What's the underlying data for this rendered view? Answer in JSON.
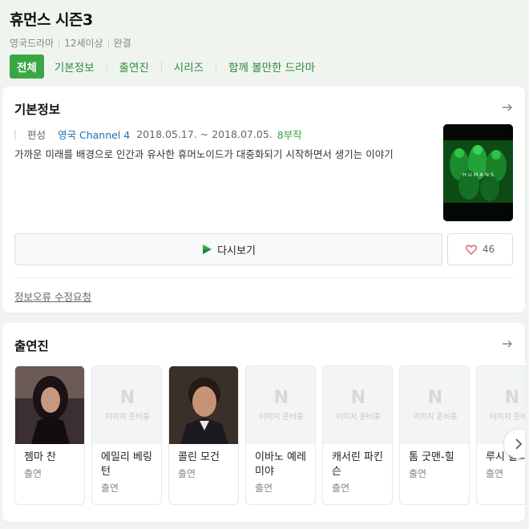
{
  "header": {
    "title": "휴먼스 시즌3",
    "meta": [
      "영국드라마",
      "12세이상",
      "완결"
    ]
  },
  "tabs": [
    {
      "label": "전체",
      "active": true
    },
    {
      "label": "기본정보",
      "active": false
    },
    {
      "label": "출연진",
      "active": false
    },
    {
      "label": "시리즈",
      "active": false
    },
    {
      "label": "함께 볼만한 드라마",
      "active": false
    }
  ],
  "info": {
    "section_title": "기본정보",
    "label": "편성",
    "network": "영국 Channel 4",
    "dates": "2018.05.17. ~ 2018.07.05.",
    "episodes": "8부작",
    "synopsis": "가까운 미래를 배경으로 인간과 유사한 휴머노이드가 대중화되기 시작하면서 생기는 이야기",
    "poster_text": "H U M A N S",
    "watch_label": "다시보기",
    "like_count": "46",
    "report_label": "정보오류 수정요청"
  },
  "cast": {
    "section_title": "출연진",
    "placeholder_n": "N",
    "placeholder_text": "이미지 준비중",
    "members": [
      {
        "name": "젬마 찬",
        "role": "출연",
        "has_photo": true
      },
      {
        "name": "에밀리 베링턴",
        "role": "출연",
        "has_photo": false
      },
      {
        "name": "콜린 모건",
        "role": "출연",
        "has_photo": true
      },
      {
        "name": "이바노 예레미야",
        "role": "출연",
        "has_photo": false
      },
      {
        "name": "캐서린 파킨슨",
        "role": "출연",
        "has_photo": false
      },
      {
        "name": "톰 굿맨-힐",
        "role": "출연",
        "has_photo": false
      },
      {
        "name": "루시 칼리스",
        "role": "출연",
        "has_photo": false
      }
    ]
  },
  "colors": {
    "accent": "#3aa746",
    "link": "#1c6fb5",
    "background": "#f0f4ef"
  }
}
